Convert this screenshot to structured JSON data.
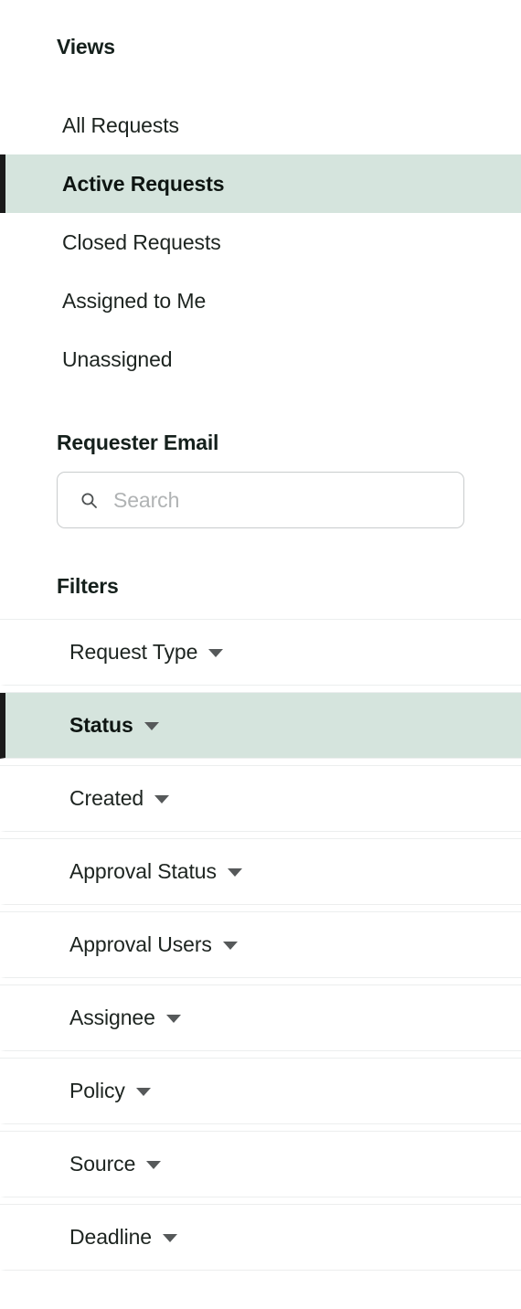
{
  "views": {
    "heading": "Views",
    "items": [
      {
        "label": "All Requests",
        "active": false
      },
      {
        "label": "Active Requests",
        "active": true
      },
      {
        "label": "Closed Requests",
        "active": false
      },
      {
        "label": "Assigned to Me",
        "active": false
      },
      {
        "label": "Unassigned",
        "active": false
      }
    ]
  },
  "requester": {
    "heading": "Requester Email",
    "search_placeholder": "Search",
    "search_value": "",
    "search_icon": "search-icon"
  },
  "filters": {
    "heading": "Filters",
    "caret_icon": "chevron-down-icon",
    "items": [
      {
        "label": "Request Type",
        "active": false
      },
      {
        "label": "Status",
        "active": true
      },
      {
        "label": "Created",
        "active": false
      },
      {
        "label": "Approval Status",
        "active": false
      },
      {
        "label": "Approval Users",
        "active": false
      },
      {
        "label": "Assignee",
        "active": false
      },
      {
        "label": "Policy",
        "active": false
      },
      {
        "label": "Source",
        "active": false
      },
      {
        "label": "Deadline",
        "active": false
      }
    ]
  },
  "colors": {
    "accent_highlight": "#d5e4dd",
    "accent_bar": "#1a1a1a",
    "text": "#1d2420",
    "placeholder": "#b0b3b4",
    "divider": "#eceeee",
    "input_border": "#c9cccd"
  }
}
